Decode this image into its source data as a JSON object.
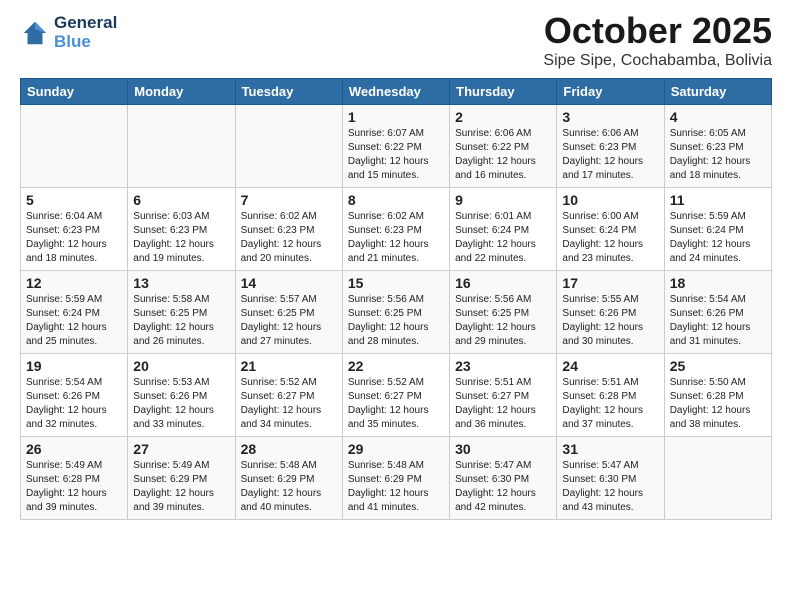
{
  "header": {
    "logo_line1": "General",
    "logo_line2": "Blue",
    "month": "October 2025",
    "location": "Sipe Sipe, Cochabamba, Bolivia"
  },
  "weekdays": [
    "Sunday",
    "Monday",
    "Tuesday",
    "Wednesday",
    "Thursday",
    "Friday",
    "Saturday"
  ],
  "weeks": [
    [
      {
        "day": "",
        "info": ""
      },
      {
        "day": "",
        "info": ""
      },
      {
        "day": "",
        "info": ""
      },
      {
        "day": "1",
        "info": "Sunrise: 6:07 AM\nSunset: 6:22 PM\nDaylight: 12 hours\nand 15 minutes."
      },
      {
        "day": "2",
        "info": "Sunrise: 6:06 AM\nSunset: 6:22 PM\nDaylight: 12 hours\nand 16 minutes."
      },
      {
        "day": "3",
        "info": "Sunrise: 6:06 AM\nSunset: 6:23 PM\nDaylight: 12 hours\nand 17 minutes."
      },
      {
        "day": "4",
        "info": "Sunrise: 6:05 AM\nSunset: 6:23 PM\nDaylight: 12 hours\nand 18 minutes."
      }
    ],
    [
      {
        "day": "5",
        "info": "Sunrise: 6:04 AM\nSunset: 6:23 PM\nDaylight: 12 hours\nand 18 minutes."
      },
      {
        "day": "6",
        "info": "Sunrise: 6:03 AM\nSunset: 6:23 PM\nDaylight: 12 hours\nand 19 minutes."
      },
      {
        "day": "7",
        "info": "Sunrise: 6:02 AM\nSunset: 6:23 PM\nDaylight: 12 hours\nand 20 minutes."
      },
      {
        "day": "8",
        "info": "Sunrise: 6:02 AM\nSunset: 6:23 PM\nDaylight: 12 hours\nand 21 minutes."
      },
      {
        "day": "9",
        "info": "Sunrise: 6:01 AM\nSunset: 6:24 PM\nDaylight: 12 hours\nand 22 minutes."
      },
      {
        "day": "10",
        "info": "Sunrise: 6:00 AM\nSunset: 6:24 PM\nDaylight: 12 hours\nand 23 minutes."
      },
      {
        "day": "11",
        "info": "Sunrise: 5:59 AM\nSunset: 6:24 PM\nDaylight: 12 hours\nand 24 minutes."
      }
    ],
    [
      {
        "day": "12",
        "info": "Sunrise: 5:59 AM\nSunset: 6:24 PM\nDaylight: 12 hours\nand 25 minutes."
      },
      {
        "day": "13",
        "info": "Sunrise: 5:58 AM\nSunset: 6:25 PM\nDaylight: 12 hours\nand 26 minutes."
      },
      {
        "day": "14",
        "info": "Sunrise: 5:57 AM\nSunset: 6:25 PM\nDaylight: 12 hours\nand 27 minutes."
      },
      {
        "day": "15",
        "info": "Sunrise: 5:56 AM\nSunset: 6:25 PM\nDaylight: 12 hours\nand 28 minutes."
      },
      {
        "day": "16",
        "info": "Sunrise: 5:56 AM\nSunset: 6:25 PM\nDaylight: 12 hours\nand 29 minutes."
      },
      {
        "day": "17",
        "info": "Sunrise: 5:55 AM\nSunset: 6:26 PM\nDaylight: 12 hours\nand 30 minutes."
      },
      {
        "day": "18",
        "info": "Sunrise: 5:54 AM\nSunset: 6:26 PM\nDaylight: 12 hours\nand 31 minutes."
      }
    ],
    [
      {
        "day": "19",
        "info": "Sunrise: 5:54 AM\nSunset: 6:26 PM\nDaylight: 12 hours\nand 32 minutes."
      },
      {
        "day": "20",
        "info": "Sunrise: 5:53 AM\nSunset: 6:26 PM\nDaylight: 12 hours\nand 33 minutes."
      },
      {
        "day": "21",
        "info": "Sunrise: 5:52 AM\nSunset: 6:27 PM\nDaylight: 12 hours\nand 34 minutes."
      },
      {
        "day": "22",
        "info": "Sunrise: 5:52 AM\nSunset: 6:27 PM\nDaylight: 12 hours\nand 35 minutes."
      },
      {
        "day": "23",
        "info": "Sunrise: 5:51 AM\nSunset: 6:27 PM\nDaylight: 12 hours\nand 36 minutes."
      },
      {
        "day": "24",
        "info": "Sunrise: 5:51 AM\nSunset: 6:28 PM\nDaylight: 12 hours\nand 37 minutes."
      },
      {
        "day": "25",
        "info": "Sunrise: 5:50 AM\nSunset: 6:28 PM\nDaylight: 12 hours\nand 38 minutes."
      }
    ],
    [
      {
        "day": "26",
        "info": "Sunrise: 5:49 AM\nSunset: 6:28 PM\nDaylight: 12 hours\nand 39 minutes."
      },
      {
        "day": "27",
        "info": "Sunrise: 5:49 AM\nSunset: 6:29 PM\nDaylight: 12 hours\nand 39 minutes."
      },
      {
        "day": "28",
        "info": "Sunrise: 5:48 AM\nSunset: 6:29 PM\nDaylight: 12 hours\nand 40 minutes."
      },
      {
        "day": "29",
        "info": "Sunrise: 5:48 AM\nSunset: 6:29 PM\nDaylight: 12 hours\nand 41 minutes."
      },
      {
        "day": "30",
        "info": "Sunrise: 5:47 AM\nSunset: 6:30 PM\nDaylight: 12 hours\nand 42 minutes."
      },
      {
        "day": "31",
        "info": "Sunrise: 5:47 AM\nSunset: 6:30 PM\nDaylight: 12 hours\nand 43 minutes."
      },
      {
        "day": "",
        "info": ""
      }
    ]
  ]
}
